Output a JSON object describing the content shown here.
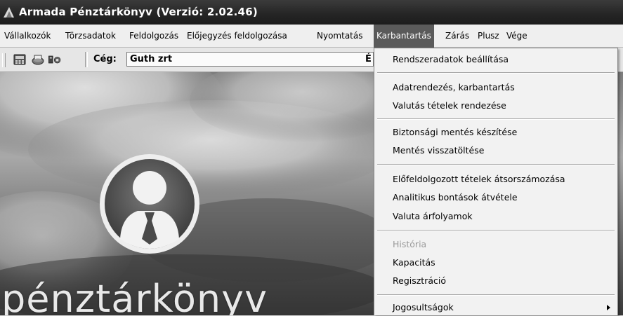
{
  "window": {
    "title": "Armada Pénztárkönyv (Verzió: 2.02.46)"
  },
  "menubar": {
    "items": [
      {
        "label": "Vállalkozók"
      },
      {
        "label": "Törzsadatok"
      },
      {
        "label": "Feldolgozás"
      },
      {
        "label": "Előjegyzés feldolgozása"
      },
      {
        "label": "Nyomtatás"
      },
      {
        "label": "Karbantartás",
        "active": true
      },
      {
        "label": "Zárás"
      },
      {
        "label": "Plusz"
      },
      {
        "label": "Vége"
      }
    ]
  },
  "toolbar": {
    "buttons": [
      "calculator-icon",
      "printer-icon",
      "settings-icon"
    ],
    "company_label": "Cég:",
    "company_value": "Guth zrt",
    "right_fragment": "É"
  },
  "dropdown": {
    "items": [
      {
        "label": "Rendszeradatok beállítása"
      },
      {
        "label": "Adatrendezés, karbantartás"
      },
      {
        "label": "Valutás tételek rendezése"
      },
      {
        "label": "Biztonsági mentés készítése"
      },
      {
        "label": "Mentés visszatöltése"
      },
      {
        "label": "Előfeldolgozott tételek átsorszámozása"
      },
      {
        "label": "Analitikus bontások átvétele"
      },
      {
        "label": "Valuta árfolyamok"
      },
      {
        "label": "História",
        "disabled": true
      },
      {
        "label": "Kapacitás"
      },
      {
        "label": "Regisztráció"
      },
      {
        "label": "Jogosultságok",
        "submenu": true
      }
    ]
  },
  "main": {
    "brand_text": "pénztárkönyv"
  },
  "colors": {
    "menu_active": "#5a5a5a",
    "titlebar": "#262626",
    "menu_background": "#f2f2f2"
  }
}
